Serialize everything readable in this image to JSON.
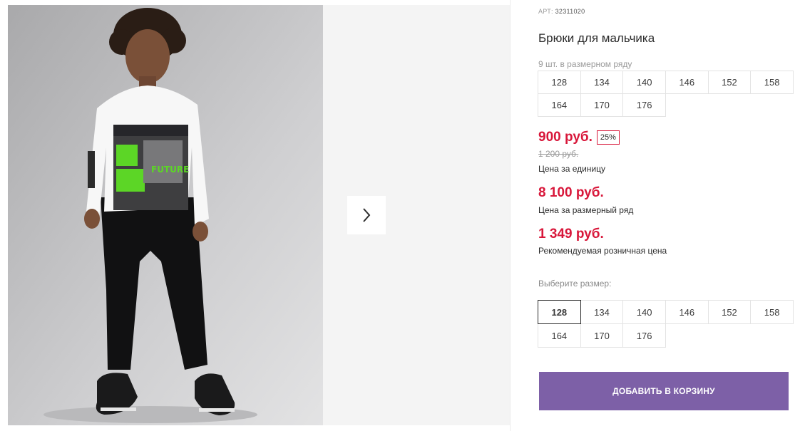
{
  "product": {
    "art_label": "АРТ:",
    "art_number": "32311020",
    "title": "Брюки для мальчика",
    "pack_note": "9 шт. в размерном ряду",
    "pack_sizes": [
      "128",
      "134",
      "140",
      "146",
      "152",
      "158",
      "164",
      "170",
      "176"
    ]
  },
  "pricing": {
    "unit_price": "900 руб.",
    "discount_badge": "25%",
    "old_price": "1 200 руб.",
    "unit_caption": "Цена за единицу",
    "pack_price": "8 100 руб.",
    "pack_caption": "Цена за размерный ряд",
    "retail_price": "1 349 руб.",
    "retail_caption": "Рекомендуемая розничная цена"
  },
  "size_select": {
    "label": "Выберите размер:",
    "options": [
      "128",
      "134",
      "140",
      "146",
      "152",
      "158",
      "164",
      "170",
      "176"
    ],
    "selected": "128"
  },
  "actions": {
    "add_to_cart": "ДОБАВИТЬ В КОРЗИНУ"
  },
  "gallery": {
    "next_icon": "chevron-right-icon",
    "shirt_print_text": "FUTURE"
  },
  "colors": {
    "price_red": "#d8173a",
    "button_purple": "#7d60a7",
    "print_green": "#5cd626"
  }
}
